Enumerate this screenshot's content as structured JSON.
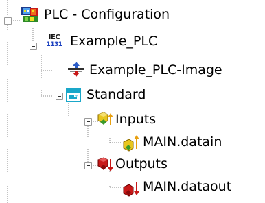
{
  "tree": {
    "root": {
      "label": "PLC - Configuration",
      "icon": "plc-configuration-icon",
      "expanded": true
    },
    "project": {
      "label": "Example_PLC",
      "icon": "iec-61131-icon",
      "icon_text_top": "IEC",
      "icon_text_bottom": "1131",
      "expanded": true
    },
    "image": {
      "label": "Example_PLC-Image",
      "icon": "process-image-icon"
    },
    "standard": {
      "label": "Standard",
      "icon": "task-icon",
      "expanded": true
    },
    "inputs": {
      "label": "Inputs",
      "icon": "inputs-icon",
      "expanded": true
    },
    "datain": {
      "label": "MAIN.datain",
      "icon": "input-variable-icon"
    },
    "outputs": {
      "label": "Outputs",
      "icon": "outputs-icon",
      "expanded": true
    },
    "dataout": {
      "label": "MAIN.dataout",
      "icon": "output-variable-icon"
    }
  },
  "colors": {
    "guide": "#8a8a8a",
    "input_yellow": "#e8c620",
    "input_green": "#3a9a2a",
    "output_red": "#c81818",
    "task_cyan": "#1aa7c9",
    "image_blue": "#2a5cc8"
  }
}
